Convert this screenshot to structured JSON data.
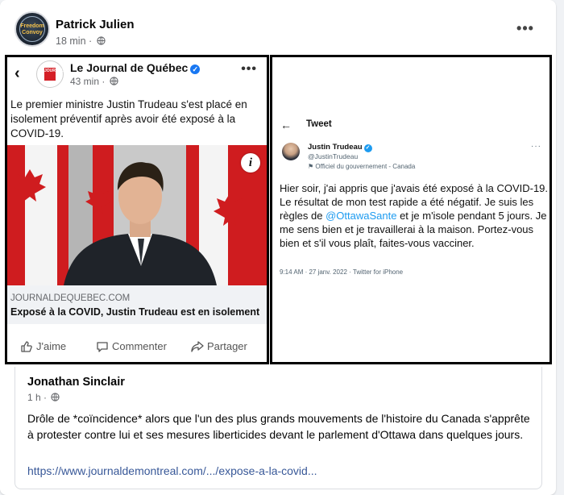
{
  "post": {
    "author": "Patrick Julien",
    "time": "18 min",
    "avatar_text": "Freedom Convoy"
  },
  "shared_fb_post": {
    "source": "Le Journal de Québec",
    "time": "43 min",
    "text": "Le premier ministre Justin Trudeau s'est placé en isolement préventif après avoir été exposé à la COVID-19.",
    "logo_text": "JOURNAL",
    "link_domain": "JOURNALDEQUEBEC.COM",
    "link_title": "Exposé à la COVID, Justin Trudeau est en isolement",
    "actions": {
      "like": "J'aime",
      "comment": "Commenter",
      "share": "Partager"
    }
  },
  "tweet": {
    "header": "Tweet",
    "name": "Justin Trudeau",
    "handle": "@JustinTrudeau",
    "label": "Officiel du gouvernement - Canada",
    "text_before": "Hier soir, j'ai appris que j'avais été exposé à la COVID-19. Le résultat de mon test rapide a été négatif. Je suis les règles de ",
    "mention": "@OttawaSante",
    "text_after": " et je m'isole pendant 5 jours. Je me sens bien et je travaillerai à la maison. Portez-vous bien et s'il vous plaît, faites-vous vacciner.",
    "timestamp": "9:14 AM · 27 janv. 2022 · Twitter for iPhone"
  },
  "comment": {
    "author": "Jonathan Sinclair",
    "time": "1 h",
    "text": "Drôle de *coïncidence* alors que l'un des plus grands mouvements de l'histoire du Canada s'apprête à protester contre lui et ses mesures liberticides devant le parlement d'Ottawa dans quelques jours.",
    "link": "https://www.journaldemontreal.com/.../expose-a-la-covid..."
  },
  "colors": {
    "facebook_blue": "#1877f2",
    "twitter_blue": "#1d9bf0",
    "link_blue": "#385898",
    "flag_red": "#cf1c1f"
  }
}
